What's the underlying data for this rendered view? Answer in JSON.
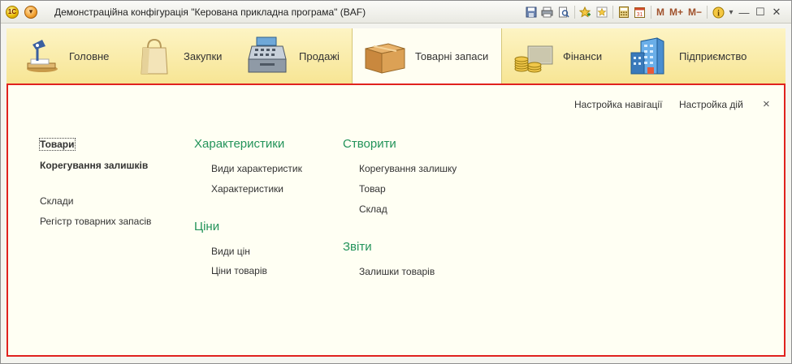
{
  "window": {
    "title": "Демонстраційна конфігурація \"Керована прикладна програма\"  (BAF)",
    "logo_text": "1С"
  },
  "toolbar": {
    "icons": [
      "save-icon",
      "print-icon",
      "print-preview-icon",
      "add-to-favorites-icon",
      "favorites-icon",
      "calculator-icon",
      "calendar-icon"
    ],
    "memory_m": "M",
    "memory_mplus": "M+",
    "memory_mminus": "M−",
    "info_symbol": "i",
    "dropdown_symbol": "▾",
    "minimize_symbol": "—",
    "maximize_symbol": "☐",
    "close_symbol": "✕"
  },
  "sections": [
    {
      "label": "Головне",
      "icon": "desk-lamp-icon"
    },
    {
      "label": "Закупки",
      "icon": "shopping-bag-icon"
    },
    {
      "label": "Продажі",
      "icon": "cash-register-icon"
    },
    {
      "label": "Товарні запаси",
      "icon": "cardboard-box-icon",
      "active": true
    },
    {
      "label": "Фінанси",
      "icon": "coins-icon"
    },
    {
      "label": "Підприємство",
      "icon": "office-building-icon"
    }
  ],
  "content": {
    "nav_settings": "Настройка навігації",
    "actions_settings": "Настройка дій",
    "close_symbol": "×",
    "col1": {
      "items": [
        {
          "label": "Товари",
          "bold": true,
          "selected": true
        },
        {
          "label": "Корегування залишків",
          "bold": true
        },
        {
          "label": "Склади",
          "bold": false
        },
        {
          "label": "Регістр товарних запасів",
          "bold": false
        }
      ]
    },
    "col2": {
      "group1_title": "Характеристики",
      "group1_items": [
        "Види характеристик",
        "Характеристики"
      ],
      "group2_title": "Ціни",
      "group2_items": [
        "Види цін",
        "Ціни товарів"
      ]
    },
    "col3": {
      "group1_title": "Створити",
      "group1_items": [
        "Корегування залишку",
        "Товар",
        "Склад"
      ],
      "group2_title": "Звіти",
      "group2_items": [
        "Залишки товарів"
      ]
    }
  },
  "colors": {
    "accent_red": "#e0221e",
    "group_green": "#23935a",
    "section_bg": "#f7e594",
    "content_bg": "#fffff3"
  }
}
